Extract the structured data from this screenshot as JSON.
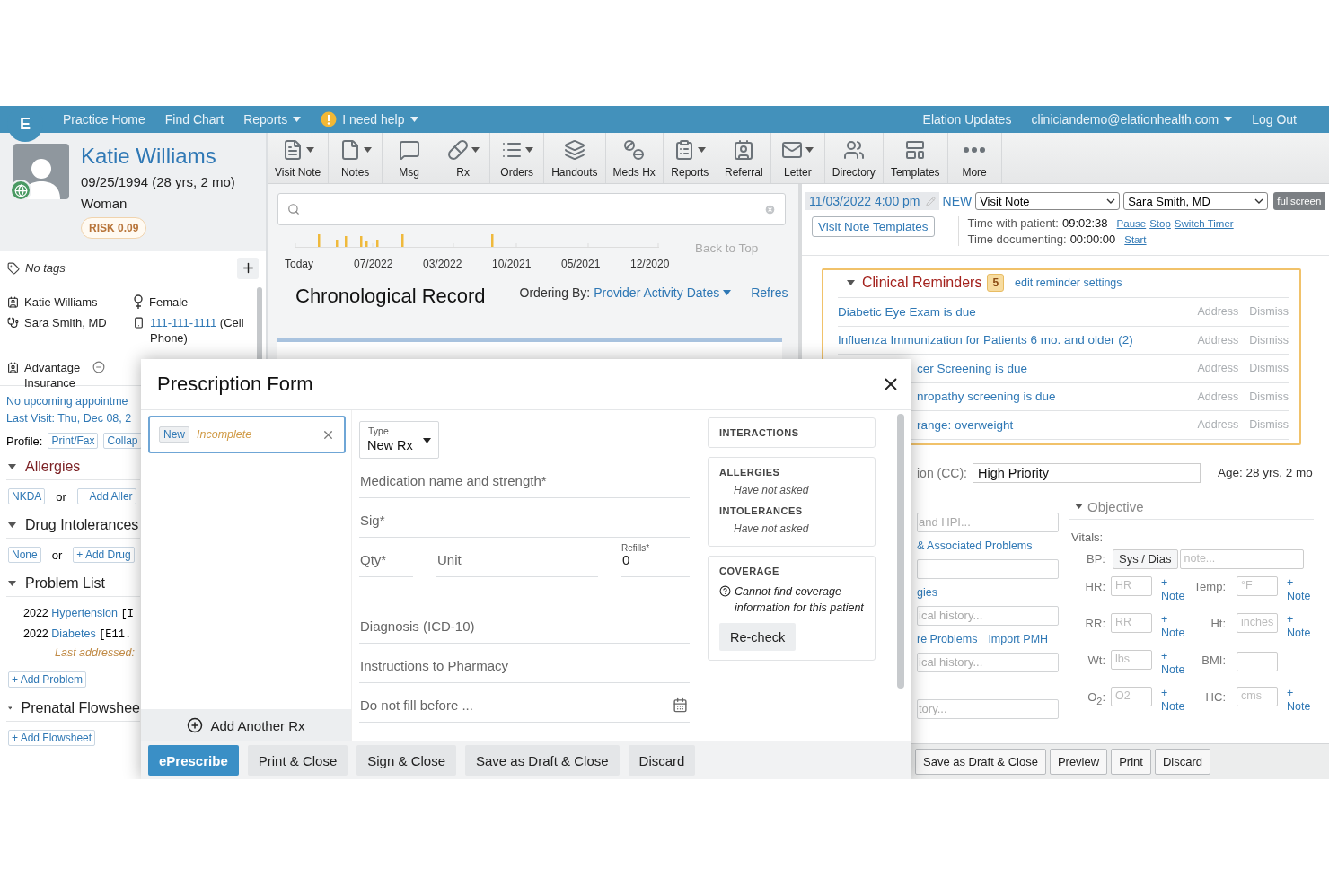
{
  "top_nav": {
    "logo": "E",
    "left": [
      {
        "label": "Practice Home",
        "dropdown": false,
        "kind": "link"
      },
      {
        "label": "Find Chart",
        "dropdown": false,
        "kind": "link"
      },
      {
        "label": "Reports",
        "dropdown": true,
        "kind": "link"
      },
      {
        "label": "I need help",
        "dropdown": true,
        "kind": "help"
      }
    ],
    "right": [
      {
        "label": "Elation Updates",
        "dropdown": false
      },
      {
        "label": "cliniciandemo@elationhealth.com",
        "dropdown": true
      },
      {
        "label": "Log Out",
        "dropdown": false
      }
    ]
  },
  "toolbar": [
    {
      "label": "Visit Note",
      "menu": true
    },
    {
      "label": "Notes",
      "menu": true
    },
    {
      "label": "Msg",
      "menu": false
    },
    {
      "label": "Rx",
      "menu": true
    },
    {
      "label": "Orders",
      "menu": true
    },
    {
      "label": "Handouts",
      "menu": false
    },
    {
      "label": "Meds Hx",
      "menu": false
    },
    {
      "label": "Reports",
      "menu": true
    },
    {
      "label": "Referral",
      "menu": false
    },
    {
      "label": "Letter",
      "menu": true
    },
    {
      "label": "Directory",
      "menu": false
    },
    {
      "label": "Templates",
      "menu": false
    },
    {
      "label": "More",
      "menu": false
    }
  ],
  "patient": {
    "name": "Katie Williams",
    "dob": "09/25/1994 (28 yrs, 2 mo)",
    "gender": "Woman",
    "risk": "RISK 0.09"
  },
  "tags": {
    "label": "No tags"
  },
  "demographics": {
    "name": "Katie Williams",
    "sex": "Female",
    "provider": "Sara Smith, MD",
    "phone": "111-111-1111",
    "phone_type": "(Cell Phone)",
    "insurance": "Advantage Insurance"
  },
  "left_lower": {
    "appointment": "No upcoming appointme",
    "last_visit": "Last Visit: Thu, Dec 08, 2",
    "profile_label": "Profile:",
    "profile_buttons": [
      "Print/Fax",
      "Collap"
    ],
    "sections": [
      {
        "title": "Allergies",
        "kind": "chips",
        "alert": true,
        "expanded": true,
        "chip": "NKDA",
        "or": "or",
        "add": "+ Add Aller"
      },
      {
        "title": "Drug Intolerances",
        "kind": "chips",
        "alert": false,
        "expanded": true,
        "chip": "None",
        "or": "or",
        "add": "+ Add Drug"
      },
      {
        "title": "Problem List",
        "kind": "problems",
        "alert": false,
        "expanded": true,
        "items": [
          {
            "year": "2022",
            "name": "Hypertension",
            "code": "[I"
          },
          {
            "year": "2022",
            "name": "Diabetes",
            "code": "[E11.",
            "note": "Last addressed:"
          }
        ],
        "add": "+ Add Problem"
      },
      {
        "title": "Prenatal Flowshee",
        "kind": "add",
        "alert": false,
        "expanded": true,
        "add": "+ Add Flowsheet"
      }
    ]
  },
  "timeline": {
    "labels": [
      "Today",
      "07/2022",
      "03/2022",
      "10/2021",
      "05/2021",
      "12/2020"
    ],
    "back_to_top": "Back to Top"
  },
  "record": {
    "title": "Chronological Record",
    "ordering_label": "Ordering By:",
    "ordering_value": "Provider Activity Dates",
    "refresh": "Refres"
  },
  "note": {
    "date": "11/03/2022 4:00 pm",
    "status": "NEW",
    "note_type": "Visit Note",
    "provider": "Sara Smith, MD",
    "fullscreen": "fullscreen",
    "templates": "Visit Note Templates",
    "timers": [
      {
        "label": "Time with patient:",
        "value": "09:02:38",
        "actions": [
          "Pause",
          "Stop",
          "Switch Timer"
        ]
      },
      {
        "label": "Time documenting:",
        "value": "00:00:00",
        "actions": [
          "Start"
        ]
      }
    ],
    "reminders": {
      "title": "Clinical Reminders",
      "count": "5",
      "settings": "edit reminder settings",
      "expanded": true,
      "items": [
        {
          "text": "Diabetic Eye Exam is due",
          "kind": "full",
          "actions": [
            "Address",
            "Dismiss"
          ]
        },
        {
          "text": "Influenza Immunization for Patients 6 mo. and older (2)",
          "kind": "full",
          "actions": [
            "Address",
            "Dismiss"
          ]
        },
        {
          "text": "cer Screening is due",
          "kind": "cut",
          "actions": [
            "Address",
            "Dismiss"
          ]
        },
        {
          "text": "nropathy screening is due",
          "kind": "cut",
          "actions": [
            "Address",
            "Dismiss"
          ]
        },
        {
          "text": "range: overweight",
          "kind": "cut",
          "actions": [
            "Address",
            "Dismiss"
          ]
        }
      ]
    },
    "cc": {
      "label": "ion (CC):",
      "value": "High Priority",
      "age": "Age: 28 yrs, 2 mo"
    },
    "left_fields": [
      {
        "kind": "input",
        "placeholder": "and HPI..."
      },
      {
        "kind": "links",
        "links": [
          "& Associated Problems"
        ]
      },
      {
        "kind": "input"
      },
      {
        "kind": "links",
        "links": [
          "gies"
        ]
      },
      {
        "kind": "input",
        "placeholder": "ical history..."
      },
      {
        "kind": "links",
        "links": [
          "re Problems",
          "Import PMH"
        ]
      },
      {
        "kind": "input",
        "placeholder": "ical history..."
      },
      {
        "kind": "input",
        "placeholder": "tory..."
      }
    ],
    "objective": {
      "title": "Objective",
      "expanded": true,
      "vitals_label": "Vitals:",
      "bp": {
        "label": "BP:",
        "button": "Sys / Dias",
        "placeholder": "note..."
      },
      "vitals": [
        {
          "label": "HR:",
          "placeholder": "HR",
          "plus": "+",
          "note": "Note"
        },
        {
          "label": "Temp:",
          "placeholder": "°F",
          "plus": "+",
          "note": "Note"
        },
        {
          "label": "RR:",
          "placeholder": "RR",
          "plus": "+",
          "note": "Note"
        },
        {
          "label": "Ht:",
          "placeholder": "inches",
          "plus": "+",
          "note": "Note"
        },
        {
          "label": "Wt:",
          "placeholder": "lbs",
          "plus": "+",
          "note": "Note"
        },
        {
          "label": "BMI:"
        },
        {
          "label": "O$_{2}$:",
          "placeholder": "O2",
          "plus": "+",
          "note": "Note"
        },
        {
          "label": "HC:",
          "placeholder": "cms",
          "plus": "+",
          "note": "Note"
        }
      ]
    },
    "footer": [
      "Save as Draft & Close",
      "Preview",
      "Print",
      "Discard"
    ]
  },
  "modal": {
    "title": "Prescription Form",
    "rx": {
      "status": "New",
      "state": "Incomplete",
      "selected": true
    },
    "add_another": "Add Another Rx",
    "type": {
      "label": "Type",
      "value": "New Rx"
    },
    "fields": [
      {
        "kind": "line",
        "placeholder": "Medication name and strength*"
      },
      {
        "kind": "line",
        "placeholder": "Sig*"
      },
      {
        "kind": "qty",
        "placeholder": "Qty*",
        "unit": "Unit",
        "refills_label": "Refills*",
        "refills": "0"
      },
      {
        "kind": "line",
        "placeholder": "Diagnosis (ICD-10)"
      },
      {
        "kind": "line",
        "placeholder": "Instructions to Pharmacy"
      },
      {
        "kind": "date",
        "placeholder": "Do not fill before ..."
      }
    ],
    "interactions": "INTERACTIONS",
    "history": [
      {
        "title": "ALLERGIES",
        "value": "Have not asked"
      },
      {
        "title": "INTOLERANCES",
        "value": "Have not asked"
      }
    ],
    "coverage": {
      "title": "COVERAGE",
      "message": "Cannot find coverage information for this patient",
      "button": "Re-check"
    },
    "buttons": [
      {
        "label": "ePrescribe",
        "kind": "primary"
      },
      {
        "label": "Print & Close",
        "kind": "default"
      },
      {
        "label": "Sign & Close",
        "kind": "default"
      },
      {
        "label": "Save as Draft & Close",
        "kind": "default"
      },
      {
        "label": "Discard",
        "kind": "default"
      }
    ]
  }
}
